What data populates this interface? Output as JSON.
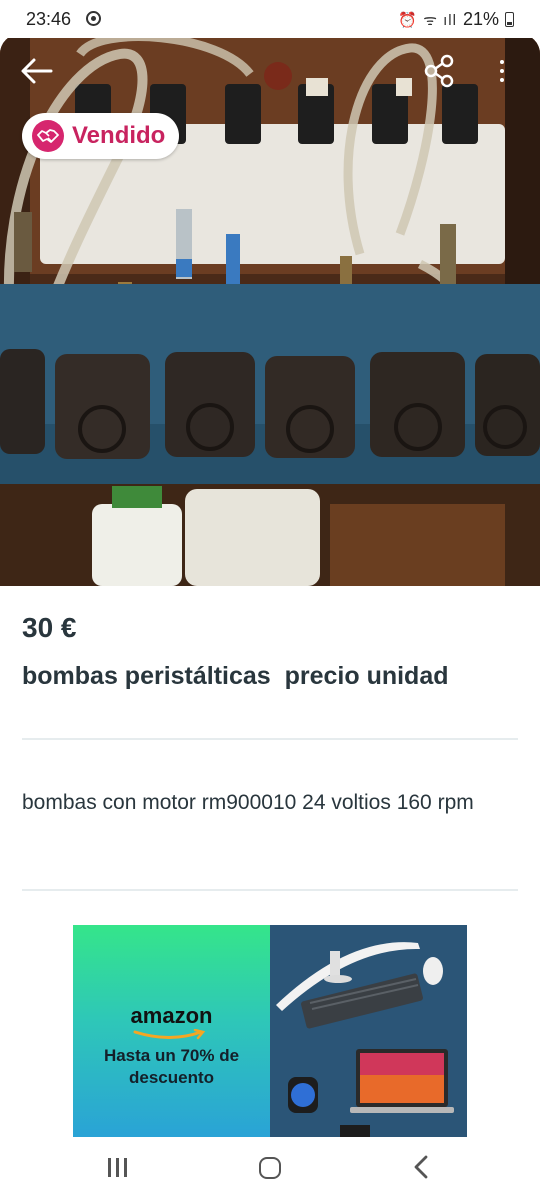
{
  "status_bar": {
    "time": "23:46",
    "icons": "⏰ ᯤ ıll",
    "battery": "21%"
  },
  "listing": {
    "sold_label": "Vendido",
    "price": "30 €",
    "title": "bombas peristálticas  precio unidad",
    "description": "bombas con motor rm900010 24 voltios  160 rpm"
  },
  "ad": {
    "brand": "amazon",
    "text": "Hasta un 70% de\ndescuento"
  },
  "colors": {
    "sold_accent": "#d6266e",
    "text_primary": "#29363d",
    "divider": "#e6ecee"
  },
  "icons": [
    "back-arrow-icon",
    "share-icon",
    "more-vertical-icon",
    "handshake-icon",
    "recent-apps-icon",
    "home-icon",
    "back-icon"
  ]
}
